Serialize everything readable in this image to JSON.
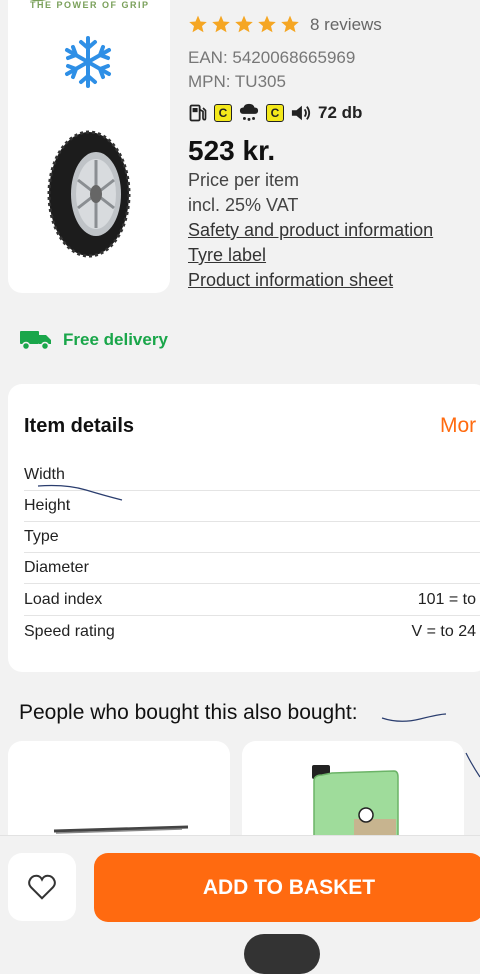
{
  "product": {
    "brand_tagline": "THE POWER OF GRIP",
    "rating_stars": 5,
    "reviews": "8 reviews",
    "ean": "EAN: 5420068665969",
    "mpn": "MPN: TU305",
    "eu_label": {
      "fuel_grade": "C",
      "wet_grade": "C",
      "noise": "72 db"
    },
    "price": "523 kr.",
    "price_note": "Price per item",
    "vat_note": "incl. 25% VAT",
    "links": {
      "safety": "Safety and product information",
      "tyre_label": "Tyre label",
      "info_sheet": "Product information sheet"
    }
  },
  "delivery": {
    "text": "Free delivery",
    "color": "#1aa64a"
  },
  "details": {
    "title": "Item details",
    "more": "Mor",
    "rows": [
      {
        "label": "Width",
        "value": ""
      },
      {
        "label": "Height",
        "value": ""
      },
      {
        "label": "Type",
        "value": ""
      },
      {
        "label": "Diameter",
        "value": ""
      },
      {
        "label": "Load index",
        "value": "101 = to"
      },
      {
        "label": "Speed rating",
        "value": "V = to 24"
      }
    ]
  },
  "also_bought": {
    "title": "People who bought this also bought:"
  },
  "actions": {
    "add_to_basket": "ADD TO BASKET"
  },
  "colors": {
    "accent": "#ff6a10",
    "star": "#f5a623",
    "label_yellow": "#f3e81b"
  }
}
